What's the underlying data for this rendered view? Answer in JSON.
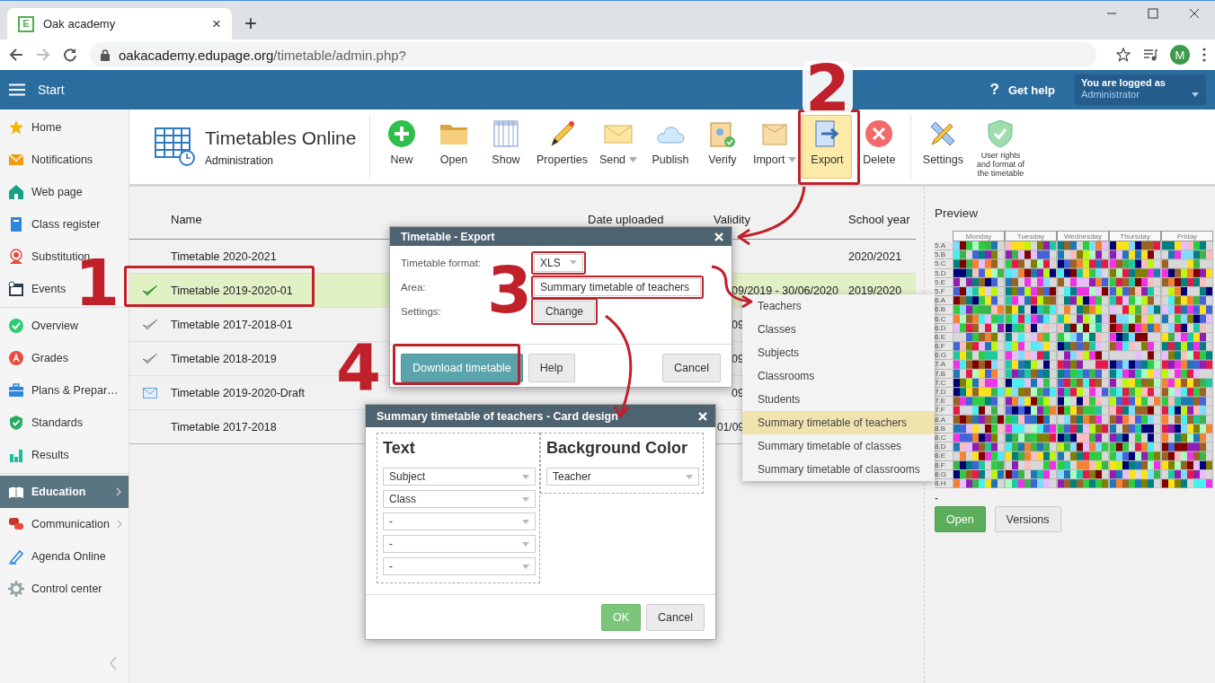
{
  "browser": {
    "favicon_letter": "E",
    "tab_title": "Oak academy",
    "tab_close": "×",
    "new_tab": "+",
    "url_host": "oakacademy.edupage.org",
    "url_path": "/timetable/admin.php?",
    "profile_initial": "M"
  },
  "app_bar": {
    "menu_label": "Start",
    "help_mark": "?",
    "help_label": "Get help",
    "login_caption": "You are logged as",
    "login_user": "Administrator"
  },
  "sidebar": {
    "sections": [
      {
        "items": [
          {
            "label": "Home",
            "selected": false,
            "submenu": false
          },
          {
            "label": "Notifications",
            "selected": false,
            "submenu": false
          },
          {
            "label": "Web page",
            "selected": false,
            "submenu": false
          },
          {
            "label": "Class register",
            "selected": false,
            "submenu": false
          },
          {
            "label": "Substitution",
            "selected": false,
            "submenu": false
          },
          {
            "label": "Events",
            "selected": false,
            "submenu": false
          }
        ]
      },
      {
        "items": [
          {
            "label": "Overview",
            "selected": false,
            "submenu": false
          },
          {
            "label": "Grades",
            "selected": false,
            "submenu": false
          },
          {
            "label": "Plans & Prepar…",
            "selected": false,
            "submenu": false
          },
          {
            "label": "Standards",
            "selected": false,
            "submenu": false
          },
          {
            "label": "Results",
            "selected": false,
            "submenu": false
          }
        ]
      },
      {
        "items": [
          {
            "label": "Education",
            "selected": true,
            "submenu": true
          },
          {
            "label": "Communication",
            "selected": false,
            "submenu": true
          },
          {
            "label": "Agenda Online",
            "selected": false,
            "submenu": false
          },
          {
            "label": "Control center",
            "selected": false,
            "submenu": false
          }
        ]
      }
    ]
  },
  "module": {
    "title": "Timetables Online",
    "subtitle": "Administration"
  },
  "toolbar": {
    "groups": [
      {
        "buttons": [
          {
            "label": "New",
            "selected": false,
            "dropdown": false
          },
          {
            "label": "Open",
            "selected": false,
            "dropdown": false
          },
          {
            "label": "Show",
            "selected": false,
            "dropdown": false
          },
          {
            "label": "Properties",
            "selected": false,
            "dropdown": false
          },
          {
            "label": "Send",
            "selected": false,
            "dropdown": true
          },
          {
            "label": "Publish",
            "selected": false,
            "dropdown": false
          },
          {
            "label": "Verify",
            "selected": false,
            "dropdown": false
          },
          {
            "label": "Import",
            "selected": false,
            "dropdown": true
          },
          {
            "label": "Export",
            "selected": true,
            "dropdown": false
          },
          {
            "label": "Delete",
            "selected": false,
            "dropdown": false
          }
        ]
      },
      {
        "buttons": [
          {
            "label": "Settings",
            "selected": false,
            "dropdown": false,
            "small": false
          },
          {
            "label": "User rights and format of the timetable",
            "selected": false,
            "dropdown": false,
            "small": true
          }
        ]
      }
    ]
  },
  "table": {
    "columns": [
      "Name",
      "Date uploaded",
      "Validity",
      "School year"
    ],
    "rows": [
      {
        "kind": "none",
        "name": "Timetable 2020-2021",
        "validity": "",
        "school_year": "2020/2021",
        "selected": false
      },
      {
        "kind": "current",
        "name": "Timetable 2019-2020-01",
        "validity": "09/2019 - 30/06/2020",
        "school_year": "2019/2020",
        "selected": true
      },
      {
        "kind": "checked",
        "name": "Timetable 2017-2018-01",
        "validity": "09",
        "school_year": "",
        "selected": false
      },
      {
        "kind": "checked",
        "name": "Timetable 2018-2019",
        "validity": "09",
        "school_year": "",
        "selected": false
      },
      {
        "kind": "draft",
        "name": "Timetable 2019-2020-Draft",
        "validity": "09",
        "school_year": "",
        "selected": false
      },
      {
        "kind": "none",
        "name": "Timetable 2017-2018",
        "validity": "01/09",
        "school_year": "",
        "selected": false
      }
    ]
  },
  "preview": {
    "title": "Preview",
    "days": [
      "Monday",
      "Tuesday",
      "Wednesday",
      "Thursday",
      "Friday"
    ],
    "classes": [
      "5.A",
      "5.B",
      "5.C",
      "5.D",
      "5.E",
      "5.F",
      "6.A",
      "6.B",
      "6.C",
      "6.D",
      "6.E",
      "6.F",
      "6.G",
      "7.A",
      "7.B",
      "7.C",
      "7.D",
      "7.E",
      "7.F",
      "8.A",
      "8.B",
      "8.C",
      "8.D",
      "8.E",
      "8.F",
      "8.G",
      "8.H"
    ],
    "note": "-",
    "buttons": [
      {
        "label": "Open",
        "kind": "primary"
      },
      {
        "label": "Versions",
        "kind": "default"
      }
    ]
  },
  "export_dialog": {
    "title": "Timetable - Export",
    "fields": [
      {
        "label": "Timetable format:",
        "value": "XLS",
        "kind": "select"
      },
      {
        "label": "Area:",
        "value": "Summary timetable of teachers",
        "kind": "select"
      },
      {
        "label": "Settings:",
        "value": "Change",
        "kind": "button"
      }
    ],
    "buttons": [
      {
        "label": "Download timetable",
        "kind": "primary"
      },
      {
        "label": "Help",
        "kind": "default"
      },
      {
        "label": "Cancel",
        "kind": "default"
      }
    ]
  },
  "area_dropdown": {
    "options": [
      {
        "label": "Teachers",
        "selected": false
      },
      {
        "label": "Classes",
        "selected": false
      },
      {
        "label": "Subjects",
        "selected": false
      },
      {
        "label": "Classrooms",
        "selected": false
      },
      {
        "label": "Students",
        "selected": false
      },
      {
        "label": "Summary timetable of teachers",
        "selected": true
      },
      {
        "label": "Summary timetable of classes",
        "selected": false
      },
      {
        "label": "Summary timetable of classrooms",
        "selected": false
      }
    ]
  },
  "card_dialog": {
    "title": "Summary timetable of teachers - Card design",
    "sections": [
      {
        "heading": "Text",
        "selects": [
          "Subject",
          "Class",
          "-",
          "-",
          "-"
        ]
      },
      {
        "heading": "Background Color",
        "selects": [
          "Teacher"
        ]
      }
    ],
    "buttons": [
      {
        "label": "OK",
        "kind": "primary"
      },
      {
        "label": "Cancel",
        "kind": "default"
      }
    ]
  },
  "annotations": {
    "steps": [
      "1",
      "2",
      "3",
      "4"
    ]
  }
}
